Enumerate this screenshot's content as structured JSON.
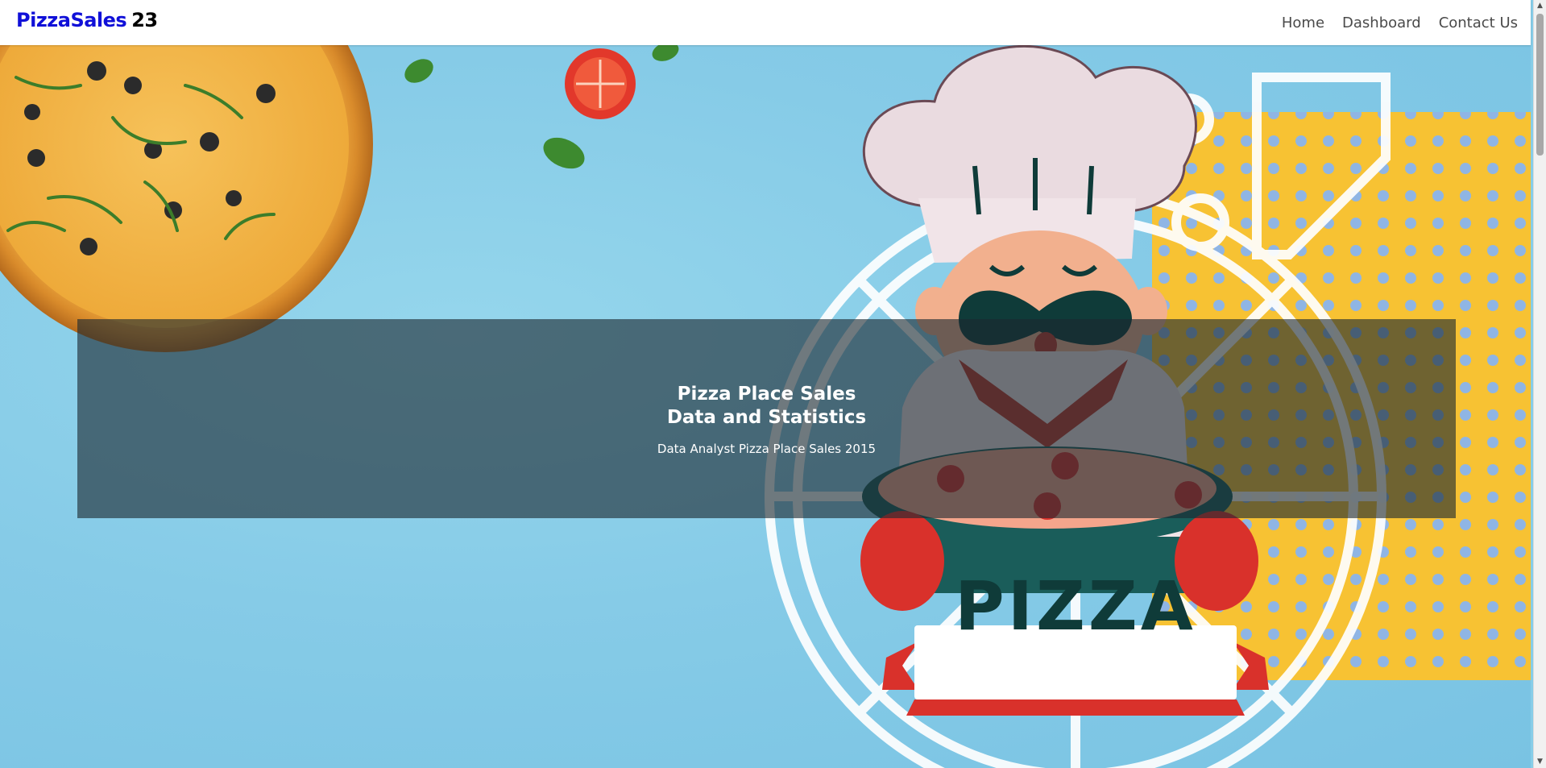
{
  "navbar": {
    "brand_primary": "PizzaSales",
    "brand_secondary": "23",
    "links": [
      "Home",
      "Dashboard",
      "Contact Us"
    ]
  },
  "hero": {
    "title_line1": "Pizza Place Sales",
    "title_line2": "Data and Statistics",
    "subtitle": "Data Analyst Pizza Place Sales 2015",
    "banner_text": "PIZZA"
  },
  "scrollbar": {
    "up_icon": "▲",
    "down_icon": "▼"
  },
  "colors": {
    "brand_blue": "#1010d8",
    "background_sky": "#87cde8",
    "accent_yellow": "#f7c233",
    "banner_red": "#d9312b",
    "dark_teal": "#0f3b39"
  }
}
